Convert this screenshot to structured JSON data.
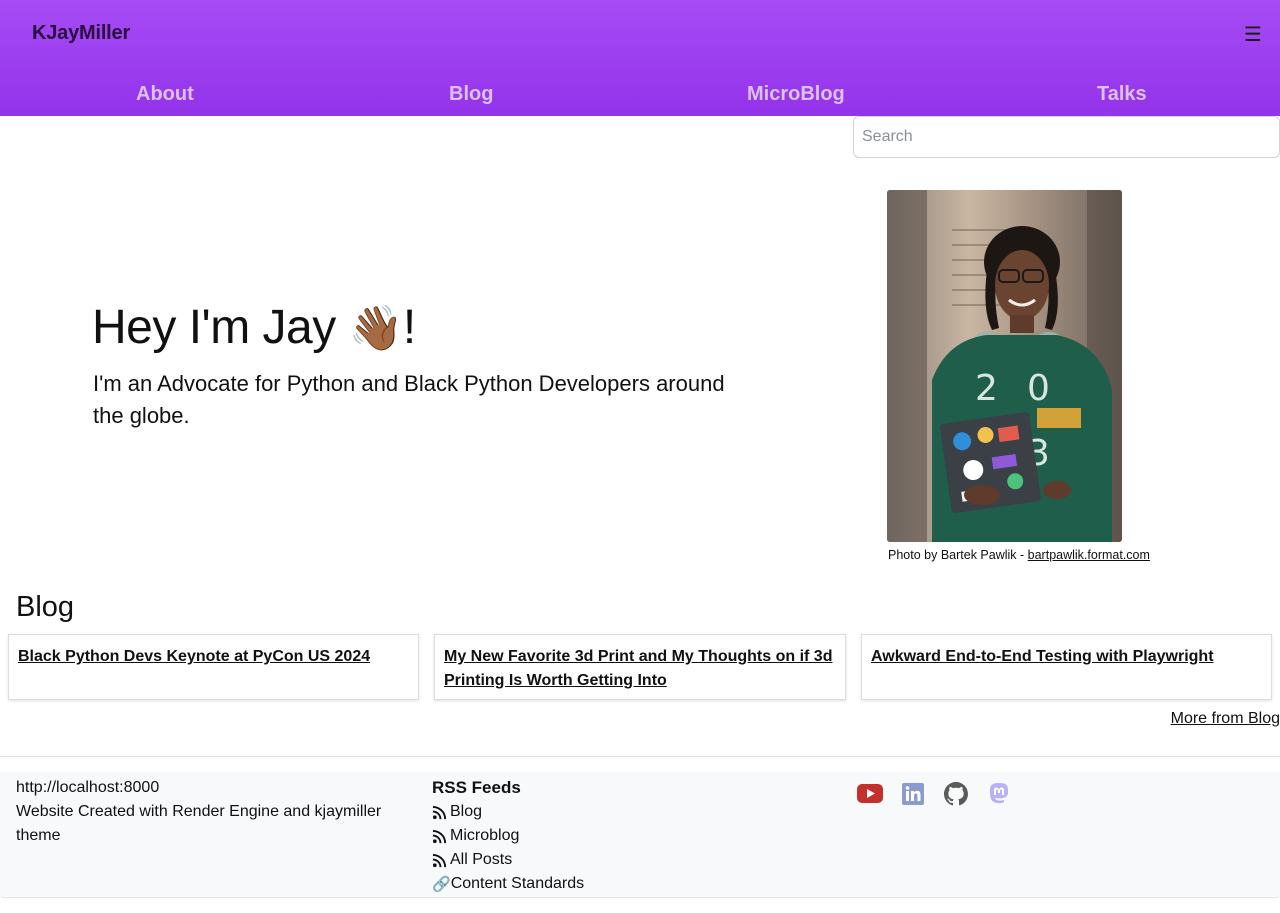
{
  "header": {
    "brand": "KJayMiller",
    "menu_icon": "hamburger-icon",
    "nav": [
      "About",
      "Blog",
      "MicroBlog",
      "Talks"
    ]
  },
  "search": {
    "placeholder": "Search",
    "value": ""
  },
  "hero": {
    "title": "Hey I'm Jay",
    "emoji": "👋🏾",
    "title_end": "!",
    "subtitle": "I'm an Advocate for Python and Black Python Developers around the globe."
  },
  "photo": {
    "caption_prefix": "Photo by Bartek Pawlik - ",
    "caption_link": "bartpawlik.format.com"
  },
  "blog": {
    "heading": "Blog",
    "posts": [
      "Black Python Devs Keynote at PyCon US 2024",
      "My New Favorite 3d Print and My Thoughts on if 3d Printing Is Worth Getting Into",
      "Awkward End-to-End Testing with Playwright"
    ],
    "more": "More from Blog"
  },
  "footer": {
    "url": "http://localhost:8000",
    "credit": "Website Created with Render Engine and kjaymiller theme",
    "rss_title": "RSS Feeds",
    "rss": [
      "Blog",
      "Microblog",
      "All Posts"
    ],
    "standards_icon": "link-icon",
    "standards": "Content Standards",
    "social": [
      "youtube-icon",
      "linkedin-icon",
      "github-icon",
      "mastodon-icon"
    ]
  },
  "colors": {
    "header_top": "#a64bf5",
    "header_bottom": "#9333ea",
    "nav_text": "#dcc1f7",
    "youtube": "#c4302b",
    "linkedin": "#8a9bd0",
    "github": "#5a5a5a",
    "mastodon": "#b9b0f5"
  }
}
